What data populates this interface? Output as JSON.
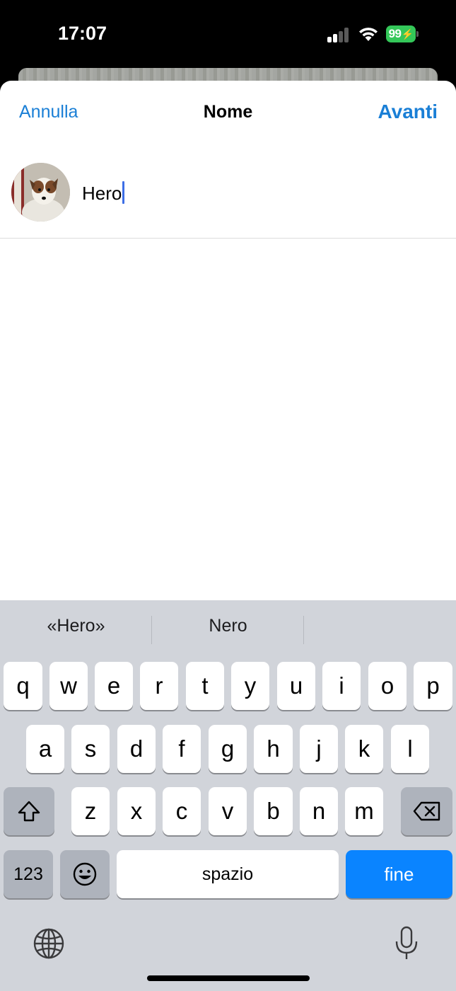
{
  "status": {
    "time": "17:07",
    "battery": "99",
    "signal_icon": "cellular-signal-icon",
    "wifi_icon": "wifi-icon",
    "battery_icon": "battery-charging-icon"
  },
  "nav": {
    "cancel": "Annulla",
    "title": "Nome",
    "next": "Avanti"
  },
  "name_field": {
    "value": "Hero",
    "avatar": "dog-avatar"
  },
  "keyboard": {
    "suggestions": [
      "«Hero»",
      "Nero",
      ""
    ],
    "row1": [
      "q",
      "w",
      "e",
      "r",
      "t",
      "y",
      "u",
      "i",
      "o",
      "p"
    ],
    "row2": [
      "a",
      "s",
      "d",
      "f",
      "g",
      "h",
      "j",
      "k",
      "l"
    ],
    "row3": [
      "z",
      "x",
      "c",
      "v",
      "b",
      "n",
      "m"
    ],
    "numbers": "123",
    "space": "spazio",
    "done": "fine",
    "shift_icon": "shift-icon",
    "delete_icon": "delete-icon",
    "emoji_icon": "emoji-icon",
    "globe_icon": "globe-icon",
    "mic_icon": "microphone-icon"
  },
  "colors": {
    "accent": "#1a7fd6",
    "done_key": "#0a84ff",
    "battery": "#34c759"
  }
}
